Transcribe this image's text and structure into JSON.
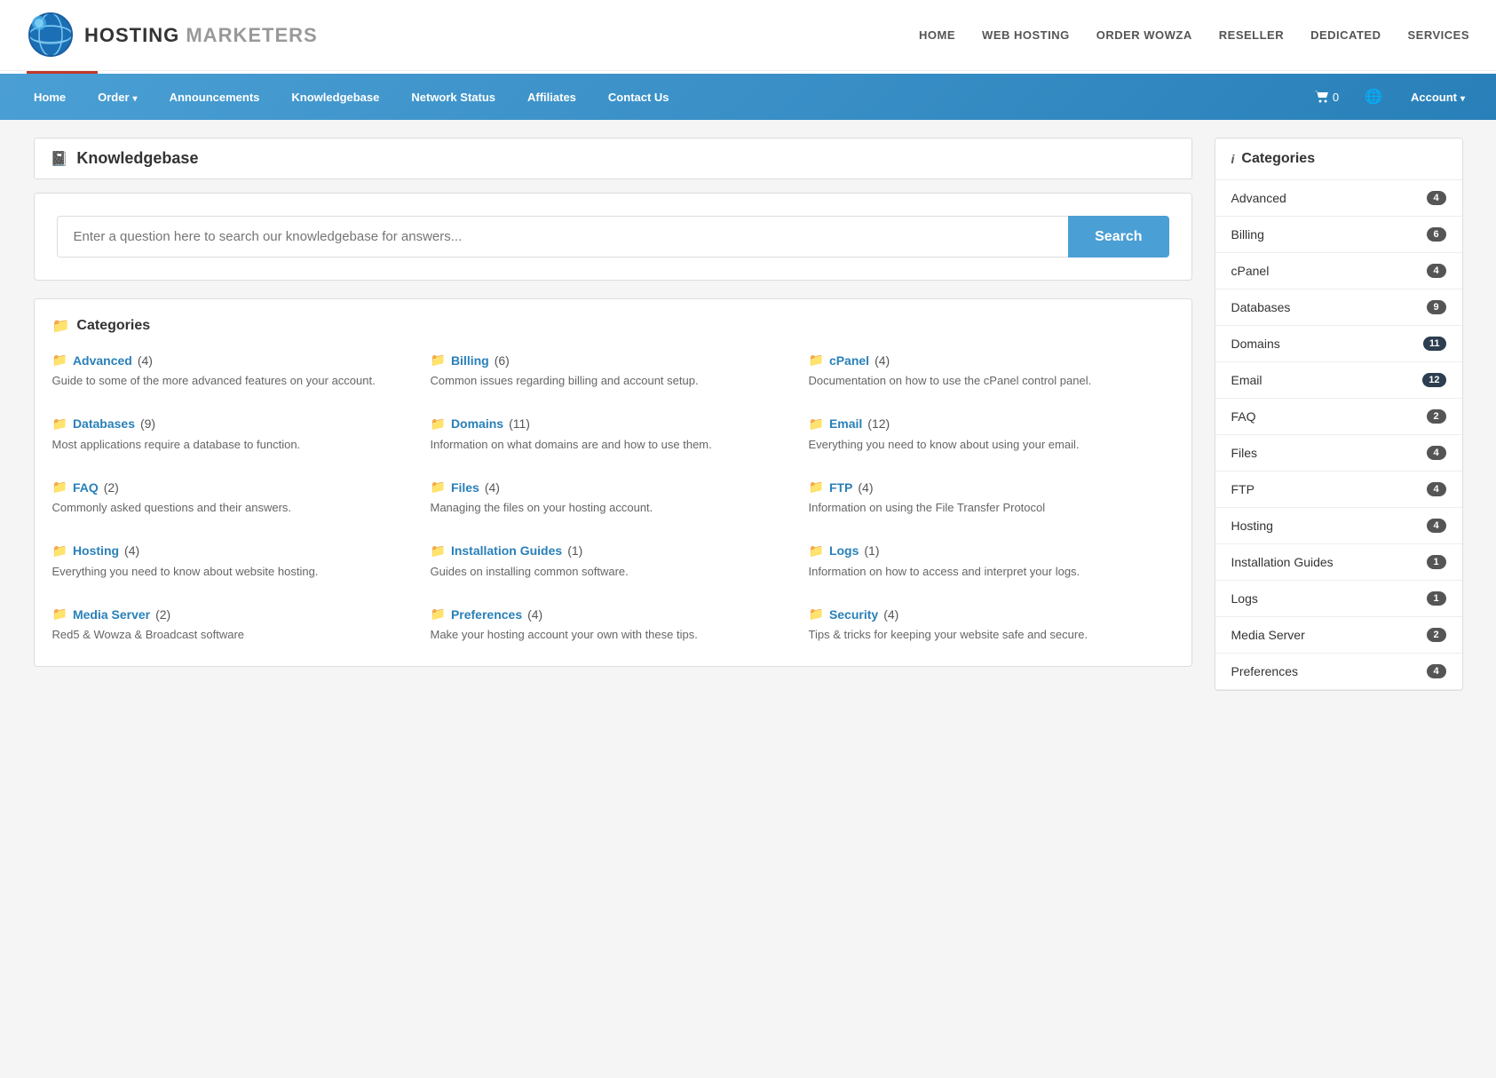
{
  "site": {
    "logo_hosting": "HOSTING",
    "logo_marketers": "MARKETERS"
  },
  "top_nav": {
    "items": [
      {
        "label": "HOME",
        "id": "home"
      },
      {
        "label": "WEB HOSTING",
        "id": "web-hosting"
      },
      {
        "label": "ORDER WOWZA",
        "id": "order-wowza"
      },
      {
        "label": "RESELLER",
        "id": "reseller"
      },
      {
        "label": "DEDICATED",
        "id": "dedicated"
      },
      {
        "label": "SERVICES",
        "id": "services"
      }
    ]
  },
  "blue_nav": {
    "items": [
      {
        "label": "Home",
        "id": "home",
        "has_dropdown": false
      },
      {
        "label": "Order",
        "id": "order",
        "has_dropdown": true
      },
      {
        "label": "Announcements",
        "id": "announcements",
        "has_dropdown": false
      },
      {
        "label": "Knowledgebase",
        "id": "knowledgebase",
        "has_dropdown": false
      },
      {
        "label": "Network Status",
        "id": "network-status",
        "has_dropdown": false
      },
      {
        "label": "Affiliates",
        "id": "affiliates",
        "has_dropdown": false
      },
      {
        "label": "Contact Us",
        "id": "contact-us",
        "has_dropdown": false
      }
    ],
    "cart_label": "0",
    "account_label": "Account"
  },
  "page": {
    "title": "Knowledgebase",
    "search_placeholder": "Enter a question here to search our knowledgebase for answers...",
    "search_button": "Search",
    "categories_title": "Categories",
    "sidebar_categories_title": "Categories"
  },
  "categories": [
    {
      "id": "advanced",
      "name": "Advanced",
      "count": 4,
      "desc": "Guide to some of the more advanced features on your account."
    },
    {
      "id": "billing",
      "name": "Billing",
      "count": 6,
      "desc": "Common issues regarding billing and account setup."
    },
    {
      "id": "cpanel",
      "name": "cPanel",
      "count": 4,
      "desc": "Documentation on how to use the cPanel control panel."
    },
    {
      "id": "databases",
      "name": "Databases",
      "count": 9,
      "desc": "Most applications require a database to function."
    },
    {
      "id": "domains",
      "name": "Domains",
      "count": 11,
      "desc": "Information on what domains are and how to use them."
    },
    {
      "id": "email",
      "name": "Email",
      "count": 12,
      "desc": "Everything you need to know about using your email."
    },
    {
      "id": "faq",
      "name": "FAQ",
      "count": 2,
      "desc": "Commonly asked questions and their answers."
    },
    {
      "id": "files",
      "name": "Files",
      "count": 4,
      "desc": "Managing the files on your hosting account."
    },
    {
      "id": "ftp",
      "name": "FTP",
      "count": 4,
      "desc": "Information on using the File Transfer Protocol"
    },
    {
      "id": "hosting",
      "name": "Hosting",
      "count": 4,
      "desc": "Everything you need to know about website hosting."
    },
    {
      "id": "installation-guides",
      "name": "Installation Guides",
      "count": 1,
      "desc": "Guides on installing common software."
    },
    {
      "id": "logs",
      "name": "Logs",
      "count": 1,
      "desc": "Information on how to access and interpret your logs."
    },
    {
      "id": "media-server",
      "name": "Media Server",
      "count": 2,
      "desc": "Red5 & Wowza & Broadcast software"
    },
    {
      "id": "preferences",
      "name": "Preferences",
      "count": 4,
      "desc": "Make your hosting account your own with these tips."
    },
    {
      "id": "security",
      "name": "Security",
      "count": 4,
      "desc": "Tips & tricks for keeping your website safe and secure."
    }
  ],
  "sidebar_categories": [
    {
      "name": "Advanced",
      "count": 4,
      "dark": false
    },
    {
      "name": "Billing",
      "count": 6,
      "dark": false
    },
    {
      "name": "cPanel",
      "count": 4,
      "dark": false
    },
    {
      "name": "Databases",
      "count": 9,
      "dark": false
    },
    {
      "name": "Domains",
      "count": 11,
      "dark": true
    },
    {
      "name": "Email",
      "count": 12,
      "dark": true
    },
    {
      "name": "FAQ",
      "count": 2,
      "dark": false
    },
    {
      "name": "Files",
      "count": 4,
      "dark": false
    },
    {
      "name": "FTP",
      "count": 4,
      "dark": false
    },
    {
      "name": "Hosting",
      "count": 4,
      "dark": false
    },
    {
      "name": "Installation Guides",
      "count": 1,
      "dark": false
    },
    {
      "name": "Logs",
      "count": 1,
      "dark": false
    },
    {
      "name": "Media Server",
      "count": 2,
      "dark": false
    },
    {
      "name": "Preferences",
      "count": 4,
      "dark": false
    }
  ]
}
